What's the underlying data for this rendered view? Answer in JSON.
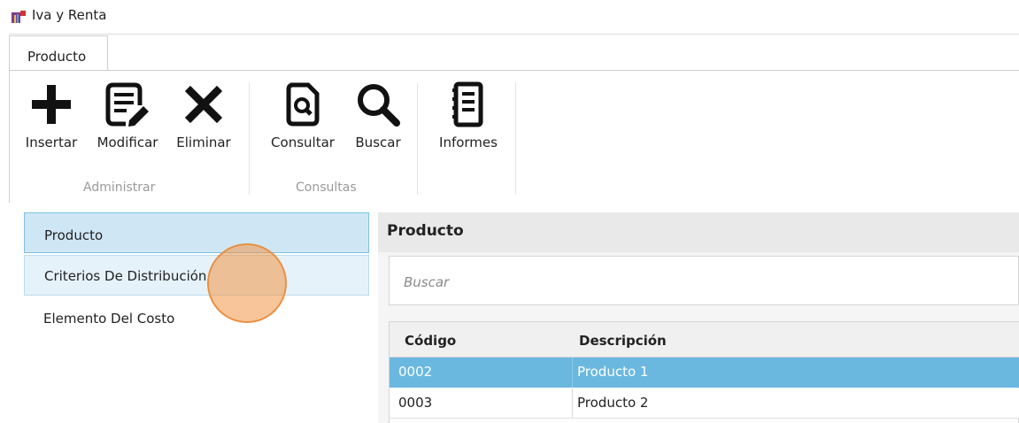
{
  "window": {
    "title": "Iva y Renta",
    "icon": "app-icon"
  },
  "ribbon": {
    "tabs": [
      {
        "label": "Producto",
        "active": true
      }
    ],
    "groups": [
      {
        "label": "Administrar",
        "buttons": [
          {
            "label": "Insertar",
            "icon": "plus-icon"
          },
          {
            "label": "Modificar",
            "icon": "edit-document-icon"
          },
          {
            "label": "Eliminar",
            "icon": "close-x-icon"
          }
        ]
      },
      {
        "label": "Consultas",
        "buttons": [
          {
            "label": "Consultar",
            "icon": "search-document-icon"
          },
          {
            "label": "Buscar",
            "icon": "magnifier-icon"
          }
        ]
      },
      {
        "label": "",
        "buttons": [
          {
            "label": "Informes",
            "icon": "report-notebook-icon"
          }
        ]
      }
    ]
  },
  "nav": {
    "items": [
      {
        "label": "Producto",
        "state": "selected"
      },
      {
        "label": "Criterios De Distribución",
        "state": "hover"
      },
      {
        "label": "Elemento Del Costo",
        "state": "normal"
      }
    ]
  },
  "panel": {
    "title": "Producto",
    "search_placeholder": "Buscar",
    "columns": [
      "Código",
      "Descripción"
    ],
    "rows": [
      {
        "codigo": "0002",
        "descripcion": "Producto 1",
        "selected": true
      },
      {
        "codigo": "0003",
        "descripcion": "Producto 2",
        "selected": false
      }
    ]
  },
  "colors": {
    "selected_row": "#6ab8e0",
    "nav_selected": "#cfe7f5",
    "nav_hover": "#e6f2fa",
    "cursor_highlight": "#f0a050"
  }
}
